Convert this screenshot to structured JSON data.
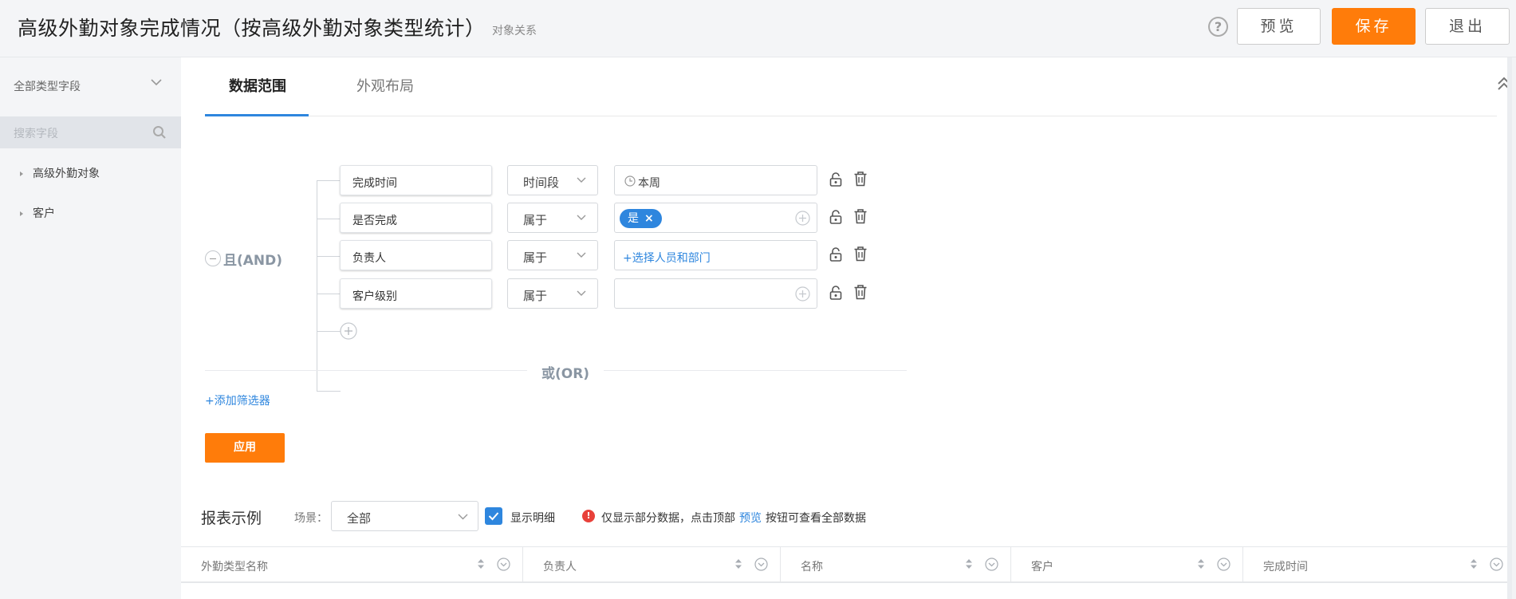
{
  "header": {
    "title": "高级外勤对象完成情况（按高级外勤对象类型统计）",
    "subtitle": "对象关系",
    "help_glyph": "?",
    "preview_label": "预览",
    "save_label": "保存",
    "exit_label": "退出"
  },
  "sidebar": {
    "field_type": "全部类型字段",
    "search_placeholder": "搜索字段",
    "items": [
      {
        "label": "高级外勤对象"
      },
      {
        "label": "客户"
      }
    ]
  },
  "tabs": {
    "data_range": "数据范围",
    "layout": "外观布局"
  },
  "filters": {
    "and_label": "且(AND)",
    "or_label": "或(OR)",
    "add_filter": "+添加筛选器",
    "apply": "应用",
    "conditions": [
      {
        "field": "完成时间",
        "op": "时间段",
        "value": "本周"
      },
      {
        "field": "是否完成",
        "op": "属于",
        "tag": "是",
        "tag_close": "×"
      },
      {
        "field": "负责人",
        "op": "属于",
        "value": "+选择人员和部门"
      },
      {
        "field": "客户级别",
        "op": "属于",
        "value": ""
      }
    ]
  },
  "report": {
    "title": "报表示例",
    "scene_label": "场景：",
    "scene_value": "全部",
    "show_detail": "显示明细",
    "warn_glyph": "!",
    "notice_before": "仅显示部分数据，点击顶部",
    "notice_link": "预览",
    "notice_after": "按钮可查看全部数据",
    "columns": [
      "外勤类型名称",
      "负责人",
      "名称",
      "客户",
      "完成时间"
    ]
  },
  "colors": {
    "accent": "#ff7c0a",
    "link": "#2e86de",
    "warning": "#e8413a"
  }
}
